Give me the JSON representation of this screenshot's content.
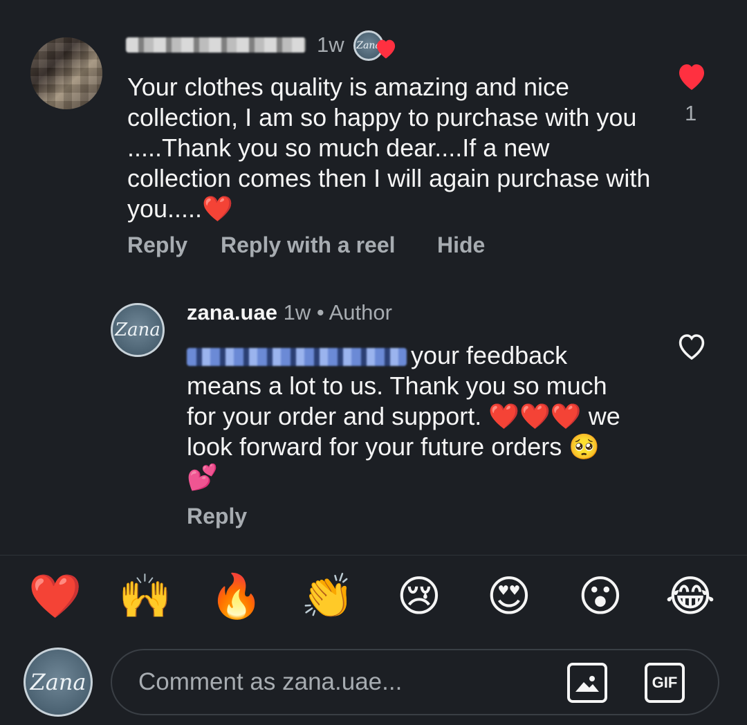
{
  "comment1": {
    "time": "1w",
    "text": "Your clothes quality is amazing and nice collection, I am so happy to purchase with you .....Thank you so much dear....If a new collection comes then I will again purchase with you.....",
    "text_emoji": "❤️",
    "like_count": "1",
    "actions": [
      "Reply",
      "Reply with a reel",
      "Hide"
    ]
  },
  "reply1": {
    "username": "zana.uae",
    "time": "1w",
    "separator": "•",
    "badge": "Author",
    "text_main": "your feedback means a lot to us. Thank you so much for your order and support.",
    "text_hearts": "❤️❤️❤️",
    "text_after": "we look forward for your future orders",
    "text_emojis": "🥺💕",
    "action": "Reply"
  },
  "reactions": [
    "❤️",
    "🙌",
    "🔥",
    "👏",
    "😢",
    "😍",
    "😮",
    "😂"
  ],
  "composer": {
    "placeholder": "Comment as zana.uae...",
    "gif_label": "GIF"
  },
  "logo_text": "Zana",
  "colors": {
    "background": "#1c1f24",
    "muted_text": "#a7acb1",
    "like_red": "#ff3040",
    "mention_blue": "#8aa6ee"
  }
}
